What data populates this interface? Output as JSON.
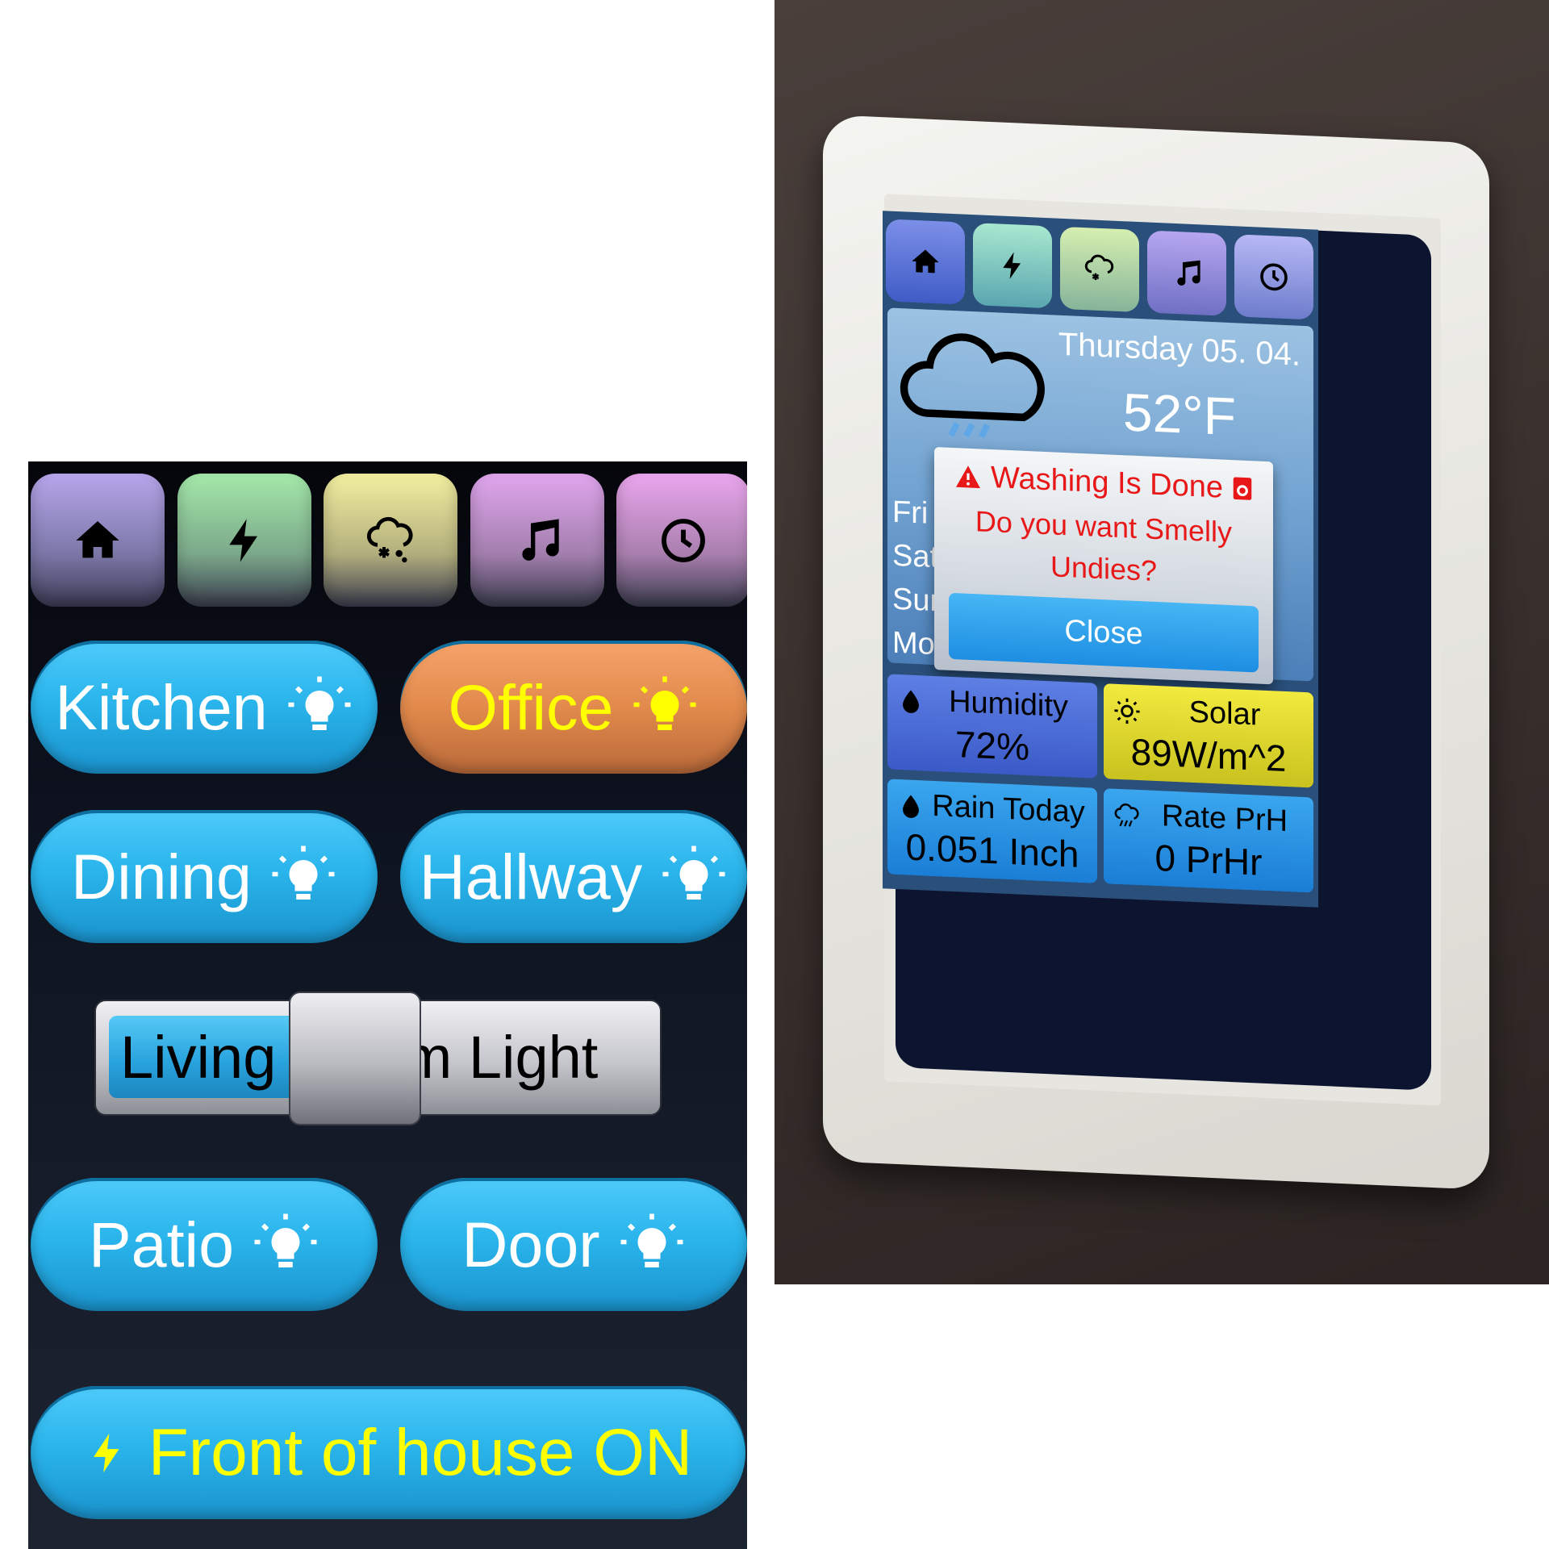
{
  "left_panel": {
    "tabs": [
      {
        "name": "home-icon",
        "color_top": "#b8a6ec",
        "color_bottom": "#3c3c56"
      },
      {
        "name": "lightning-icon",
        "color_top": "#a5e9a9",
        "color_bottom": "#3b3d4e"
      },
      {
        "name": "weather-snow-icon",
        "color_top": "#f3efa0",
        "color_bottom": "#3b3d4e"
      },
      {
        "name": "music-note-icon",
        "color_top": "#e1a6ee",
        "color_bottom": "#3b3d4e"
      },
      {
        "name": "clock-icon",
        "color_top": "#eba6ee",
        "color_bottom": "#3b3d4e"
      }
    ],
    "lights": {
      "kitchen": "Kitchen",
      "office": "Office",
      "dining": "Dining",
      "hallway": "Hallway",
      "patio": "Patio",
      "door": "Door"
    },
    "slider": {
      "label": "Living Room Light",
      "level": 0.45
    },
    "front_button": "Front of house ON",
    "colors": {
      "accent_blue": "#2ab5ec",
      "office_orange": "#e28a4c",
      "highlight_yellow": "#ffff00"
    }
  },
  "device": {
    "weather": {
      "date": "Thursday 05. 04.",
      "temperature": "52°F",
      "days": [
        "Fri",
        "Sat",
        "Sun",
        "Mo"
      ]
    },
    "dialog": {
      "title": "Washing Is Done",
      "message": "Do you want Smelly Undies?",
      "close_label": "Close"
    },
    "tiles": {
      "humidity": {
        "label": "Humidity",
        "value": "72%"
      },
      "solar": {
        "label": "Solar",
        "value": "89W/m^2"
      },
      "rain_today": {
        "label": "Rain Today",
        "value": "0.051 Inch"
      },
      "rate": {
        "label": "Rate PrH",
        "value": "0 PrHr"
      }
    }
  }
}
